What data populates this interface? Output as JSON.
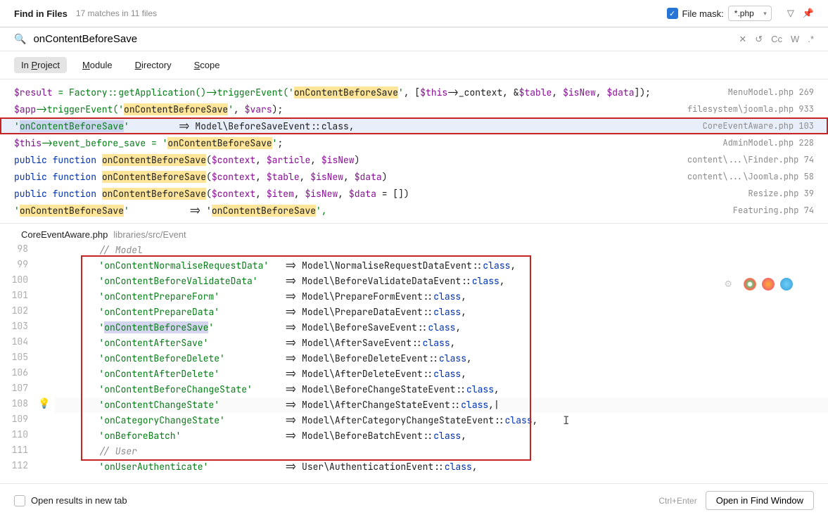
{
  "header": {
    "title": "Find in Files",
    "subtitle": "17 matches in 11 files",
    "file_mask_label": "File mask:",
    "file_mask_value": "*.php"
  },
  "search": {
    "query": "onContentBeforeSave",
    "tool_cc": "Cc",
    "tool_w": "W",
    "tool_dot": ".*"
  },
  "scope_tabs": [
    "In Project",
    "Module",
    "Directory",
    "Scope"
  ],
  "results": [
    {
      "pre": "$result = Factory::getApplication()->triggerEvent('",
      "hl": "onContentBeforeSave",
      "post": "', [$this->_context, &$table, $isNew, $data]);",
      "file": "MenuModel.php",
      "line": "269",
      "vars": [
        "$result",
        "$this",
        "$table",
        "$isNew",
        "$data"
      ]
    },
    {
      "pre": "$app->triggerEvent('",
      "hl": "onContentBeforeSave",
      "post": "', $vars);",
      "file": "filesystem\\joomla.php",
      "line": "933",
      "vars": [
        "$app",
        "$vars"
      ]
    },
    {
      "selected": true,
      "pre": "'",
      "hl": "onContentBeforeSave",
      "post": "'         => Model\\BeforeSaveEvent::class,",
      "file": "CoreEventAware.php",
      "line": "103"
    },
    {
      "pre": "$this->event_before_save = '",
      "hl": "onContentBeforeSave",
      "post": "';",
      "file": "AdminModel.php",
      "line": "228",
      "vars": [
        "$this"
      ]
    },
    {
      "kw": "public function ",
      "hl": "onContentBeforeSave",
      "post2": "($context, $article, $isNew)",
      "file": "content\\...\\Finder.php",
      "line": "74",
      "vars": [
        "$context",
        "$article",
        "$isNew"
      ]
    },
    {
      "kw": "public function ",
      "hl": "onContentBeforeSave",
      "post2": "($context, $table, $isNew, $data)",
      "file": "content\\...\\Joomla.php",
      "line": "58",
      "vars": [
        "$context",
        "$table",
        "$isNew",
        "$data"
      ]
    },
    {
      "kw": "public function ",
      "hl": "onContentBeforeSave",
      "post2": "($context, $item, $isNew, $data = [])",
      "file": "Resize.php",
      "line": "39",
      "vars": [
        "$context",
        "$item",
        "$isNew",
        "$data"
      ]
    },
    {
      "pre": "'",
      "hl": "onContentBeforeSave",
      "post": "'           => '",
      "hl2": "onContentBeforeSave",
      "post3": "',",
      "file": "Featuring.php",
      "line": "74"
    }
  ],
  "preview": {
    "file": "CoreEventAware.php",
    "path": "libraries/src/Event",
    "lines": [
      {
        "n": "98",
        "cmt": "// Model"
      },
      {
        "n": "99",
        "key": "onContentNormaliseRequestData",
        "cls": "Model\\NormaliseRequestDataEvent"
      },
      {
        "n": "100",
        "key": "onContentBeforeValidateData",
        "cls": "Model\\BeforeValidateDataEvent"
      },
      {
        "n": "101",
        "key": "onContentPrepareForm",
        "cls": "Model\\PrepareFormEvent"
      },
      {
        "n": "102",
        "key": "onContentPrepareData",
        "cls": "Model\\PrepareDataEvent"
      },
      {
        "n": "103",
        "key": "onContentBeforeSave",
        "cls": "Model\\BeforeSaveEvent",
        "current": true,
        "hl": true
      },
      {
        "n": "104",
        "key": "onContentAfterSave",
        "cls": "Model\\AfterSaveEvent"
      },
      {
        "n": "105",
        "key": "onContentBeforeDelete",
        "cls": "Model\\BeforeDeleteEvent"
      },
      {
        "n": "106",
        "key": "onContentAfterDelete",
        "cls": "Model\\AfterDeleteEvent"
      },
      {
        "n": "107",
        "key": "onContentBeforeChangeState",
        "cls": "Model\\BeforeChangeStateEvent"
      },
      {
        "n": "108",
        "key": "onContentChangeState",
        "cls": "Model\\AfterChangeStateEvent",
        "cursor": true
      },
      {
        "n": "109",
        "key": "onCategoryChangeState",
        "cls": "Model\\AfterCategoryChangeStateEvent"
      },
      {
        "n": "110",
        "key": "onBeforeBatch",
        "cls": "Model\\BeforeBatchEvent"
      },
      {
        "n": "111",
        "cmt": "// User"
      },
      {
        "n": "112",
        "key": "onUserAuthenticate",
        "cls": "User\\AuthenticationEvent"
      }
    ]
  },
  "footer": {
    "open_tab": "Open results in new tab",
    "hint": "Ctrl+Enter",
    "button": "Open in Find Window"
  }
}
